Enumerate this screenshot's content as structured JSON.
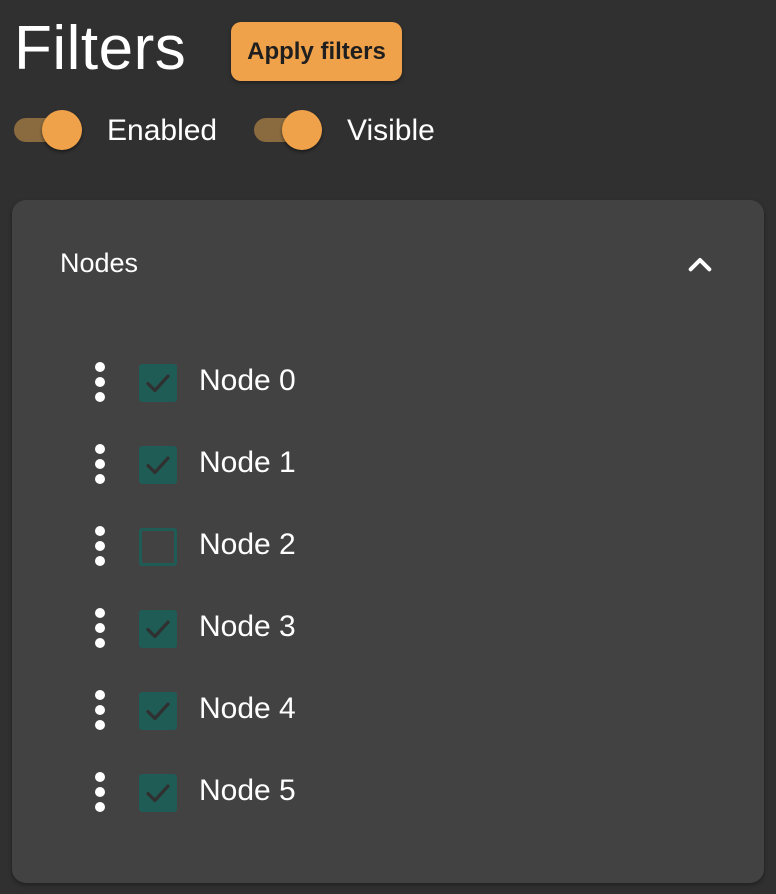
{
  "header": {
    "title": "Filters",
    "apply_button_label": "Apply filters"
  },
  "toggles": {
    "enabled": {
      "label": "Enabled",
      "on": true
    },
    "visible": {
      "label": "Visible",
      "on": true
    }
  },
  "panel": {
    "title": "Nodes",
    "expanded": true,
    "items": [
      {
        "label": "Node 0",
        "checked": true
      },
      {
        "label": "Node 1",
        "checked": true
      },
      {
        "label": "Node 2",
        "checked": false
      },
      {
        "label": "Node 3",
        "checked": true
      },
      {
        "label": "Node 4",
        "checked": true
      },
      {
        "label": "Node 5",
        "checked": true
      }
    ]
  },
  "colors": {
    "background": "#303030",
    "panel": "#424242",
    "accent": "#f0a24a",
    "toggle_track": "#8a6a3f",
    "checkbox": "#1f5c55",
    "text": "#ffffff"
  },
  "icons": {
    "collapse": "chevron-up-icon",
    "drag": "drag-handle-icon",
    "check": "check-icon"
  }
}
